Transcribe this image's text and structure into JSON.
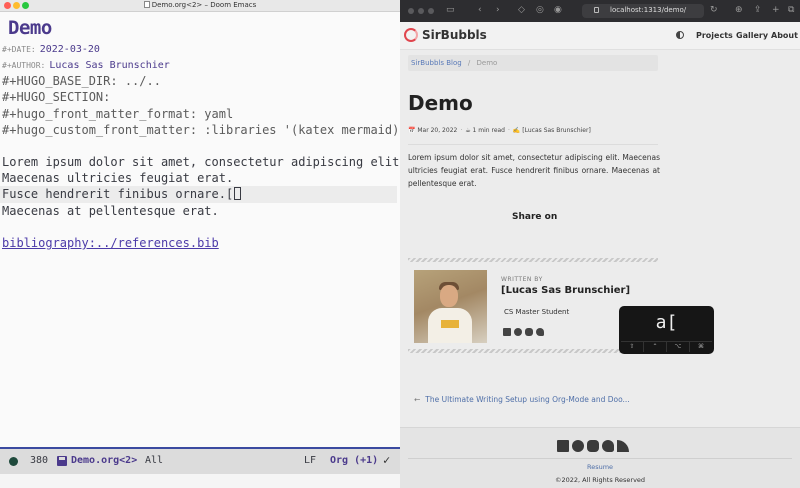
{
  "emacs": {
    "window_title": "Demo.org<2> – Doom Emacs",
    "org_title": "Demo",
    "keywords": [
      {
        "key": "#+DATE:",
        "value": "2022-03-20"
      },
      {
        "key": "#+AUTHOR:",
        "value": "Lucas Sas Brunschier"
      }
    ],
    "settings": [
      "#+HUGO_BASE_DIR: ../..",
      "#+HUGO_SECTION:",
      "#+hugo_front_matter_format: yaml",
      "#+hugo_custom_front_matter: :libraries '(katex mermaid)"
    ],
    "body": [
      "Lorem ipsum dolor sit amet, consectetur adipiscing elit.",
      "Maecenas ultricies feugiat erat.",
      "Fusce hendrerit finibus ornare.[",
      "Maecenas at pellentesque erat."
    ],
    "link": "bibliography:../references.bib",
    "modeline": {
      "number": "380",
      "buffer": "Demo.org<2>",
      "position": "All",
      "eol": "LF",
      "mode": "Org (+1)",
      "check": "✓"
    }
  },
  "browser": {
    "url": "localhost:1313/demo/",
    "site_name": "SirBubbls",
    "nav": [
      "Projects",
      "Gallery",
      "About"
    ],
    "breadcrumb": {
      "parent": "SirBubbls Blog",
      "sep": "/",
      "current": "Demo"
    },
    "post_title": "Demo",
    "meta": {
      "date": "📅 Mar 20, 2022",
      "read": "☕ 1 min read",
      "author": "✍️ [Lucas Sas Brunschier]",
      "sep": "·"
    },
    "body": "Lorem ipsum dolor sit amet, consectetur adipiscing elit. Maecenas ultricies feugiat erat. Fusce hendrerit finibus ornare. Maecenas at pellentesque erat.",
    "share": "Share on",
    "author_card": {
      "written_by": "WRITTEN BY",
      "name": "[Lucas Sas Brunschier]",
      "role": "CS Master Student"
    },
    "prev_post": "The Ultimate Writing Setup using Org-Mode and Doo...",
    "footer": {
      "resume": "Resume",
      "copyright": "©2022, All Rights Reserved"
    }
  },
  "key_overlay": {
    "keys": "a[",
    "modifiers": [
      "⇧",
      "⌃",
      "⌥",
      "⌘"
    ]
  }
}
